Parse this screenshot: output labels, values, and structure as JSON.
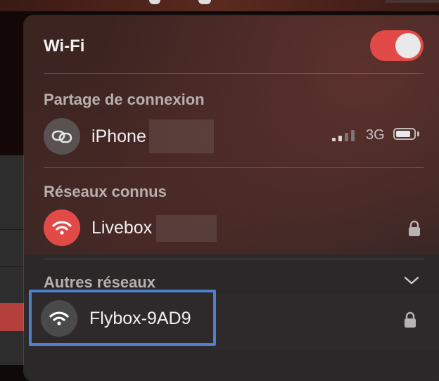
{
  "wifi": {
    "title": "Wi-Fi",
    "enabled": true,
    "toggle_color": "#e14a47"
  },
  "hotspot": {
    "section_label": "Partage de connexion",
    "device": {
      "name": "iPhone",
      "icon": "link-icon",
      "network_type": "3G",
      "signal_bars_active": 2,
      "signal_bars_total": 4
    }
  },
  "known": {
    "section_label": "Réseaux connus",
    "networks": [
      {
        "name": "Livebox",
        "icon": "wifi-icon",
        "icon_bg": "#e14a47",
        "locked": true
      }
    ]
  },
  "other": {
    "section_label": "Autres réseaux",
    "expand_icon": "chevron-down-icon",
    "networks": [
      {
        "name": "Flybox-9AD9",
        "icon": "wifi-icon",
        "icon_bg": "#4a4a4b",
        "locked": true,
        "focused": true
      }
    ]
  },
  "colors": {
    "accent_red": "#e14a47",
    "focus_blue": "#4f80cf"
  }
}
